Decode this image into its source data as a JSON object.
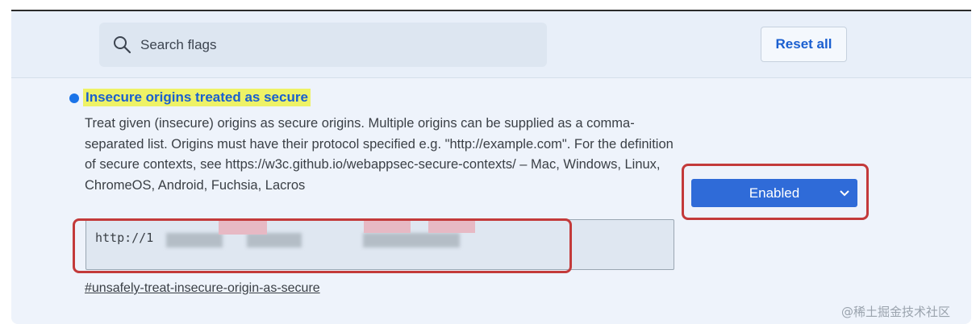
{
  "header": {
    "search_placeholder": "Search flags",
    "reset_label": "Reset all"
  },
  "flag": {
    "title": "Insecure origins treated as secure",
    "description": "Treat given (insecure) origins as secure origins. Multiple origins can be supplied as a comma-separated list. Origins must have their protocol specified e.g. \"http://example.com\". For the definition of secure contexts, see https://w3c.github.io/webappsec-secure-contexts/ – Mac, Windows, Linux, ChromeOS, Android, Fuchsia, Lacros",
    "origins_value": "http://1",
    "status": "Enabled",
    "link": "#unsafely-treat-insecure-origin-as-secure"
  },
  "watermark": "@稀土掘金技术社区",
  "colors": {
    "accent": "#1a73e8",
    "select_bg": "#2f6bd8",
    "highlight": "#eef266",
    "annotation": "#c33a3a"
  },
  "icons": {
    "search": "search-icon",
    "select_arrow": "chevron-down-icon",
    "flag_marker": "dot-indicator"
  }
}
